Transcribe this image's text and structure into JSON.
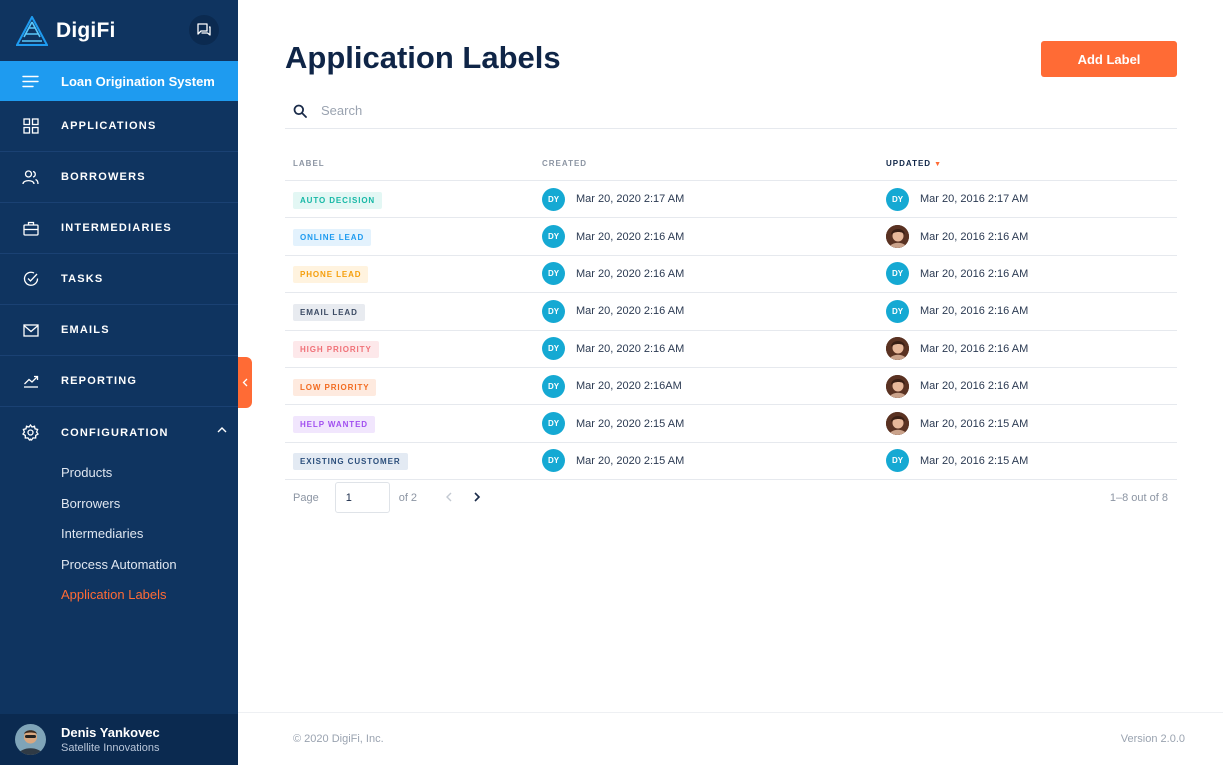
{
  "brand": {
    "name": "DigiFi"
  },
  "sidebar": {
    "section_title": "Loan Origination System",
    "items": [
      {
        "label": "APPLICATIONS",
        "icon": "grid-icon"
      },
      {
        "label": "BORROWERS",
        "icon": "users-icon"
      },
      {
        "label": "INTERMEDIARIES",
        "icon": "briefcase-icon"
      },
      {
        "label": "TASKS",
        "icon": "check-circle-icon"
      },
      {
        "label": "EMAILS",
        "icon": "mail-icon"
      },
      {
        "label": "REPORTING",
        "icon": "chart-line-icon"
      }
    ],
    "config": {
      "label": "CONFIGURATION",
      "subitems": [
        "Products",
        "Borrowers",
        "Intermediaries",
        "Process Automation",
        "Application Labels"
      ],
      "active": "Application Labels"
    },
    "user": {
      "name": "Denis Yankovec",
      "company": "Satellite Innovations"
    }
  },
  "page": {
    "title": "Application Labels",
    "add_button": "Add Label"
  },
  "search": {
    "placeholder": "Search"
  },
  "table": {
    "headers": {
      "label": "LABEL",
      "created": "CREATED",
      "updated": "UPDATED"
    },
    "sort_column": "updated",
    "rows": [
      {
        "label": "AUTO DECISION",
        "fg": "#17b8a6",
        "bg": "#e3f7f4",
        "created_by": "DY",
        "created": "Mar 20, 2020 2:17 AM",
        "updated_by": "DY",
        "updated": "Mar 20, 2016 2:17 AM"
      },
      {
        "label": "ONLINE LEAD",
        "fg": "#1e9bf0",
        "bg": "#e3f2fd",
        "created_by": "DY",
        "created": "Mar 20, 2020 2:16 AM",
        "updated_by": "photo",
        "updated": "Mar 20, 2016 2:16 AM"
      },
      {
        "label": "PHONE LEAD",
        "fg": "#f59e0b",
        "bg": "#fff3df",
        "created_by": "DY",
        "created": "Mar 20, 2020 2:16 AM",
        "updated_by": "DY",
        "updated": "Mar 20, 2016 2:16 AM"
      },
      {
        "label": "EMAIL LEAD",
        "fg": "#3b4a63",
        "bg": "#e8ebf0",
        "created_by": "DY",
        "created": "Mar 20, 2020 2:16 AM",
        "updated_by": "DY",
        "updated": "Mar 20, 2016 2:16 AM"
      },
      {
        "label": "HIGH PRIORITY",
        "fg": "#f07178",
        "bg": "#fde8ea",
        "created_by": "DY",
        "created": "Mar 20, 2020 2:16 AM",
        "updated_by": "photo",
        "updated": "Mar 20, 2016 2:16 AM"
      },
      {
        "label": "LOW PRIORITY",
        "fg": "#f26b21",
        "bg": "#feeadf",
        "created_by": "DY",
        "created": "Mar 20, 2020 2:16AM",
        "updated_by": "photo",
        "updated": "Mar 20, 2016 2:16 AM"
      },
      {
        "label": "HELP WANTED",
        "fg": "#a14ff0",
        "bg": "#f1e6fd",
        "created_by": "DY",
        "created": "Mar 20, 2020 2:15 AM",
        "updated_by": "photo",
        "updated": "Mar 20, 2016 2:15 AM"
      },
      {
        "label": "EXISTING CUSTOMER",
        "fg": "#2c4f7c",
        "bg": "#e3eaf3",
        "created_by": "DY",
        "created": "Mar 20, 2020 2:15 AM",
        "updated_by": "DY",
        "updated": "Mar 20, 2016 2:15 AM"
      }
    ]
  },
  "pagination": {
    "page_label": "Page",
    "current_page": "1",
    "of_label": "of 2",
    "count": "1–8 out of 8"
  },
  "footer": {
    "copyright": "© 2020 DigiFi, Inc.",
    "version": "Version 2.0.0"
  },
  "colors": {
    "sidebar": "#0f3460",
    "accent": "#ff6b35",
    "active_nav": "#1e9bf0",
    "avatar": "#15a9d3"
  }
}
